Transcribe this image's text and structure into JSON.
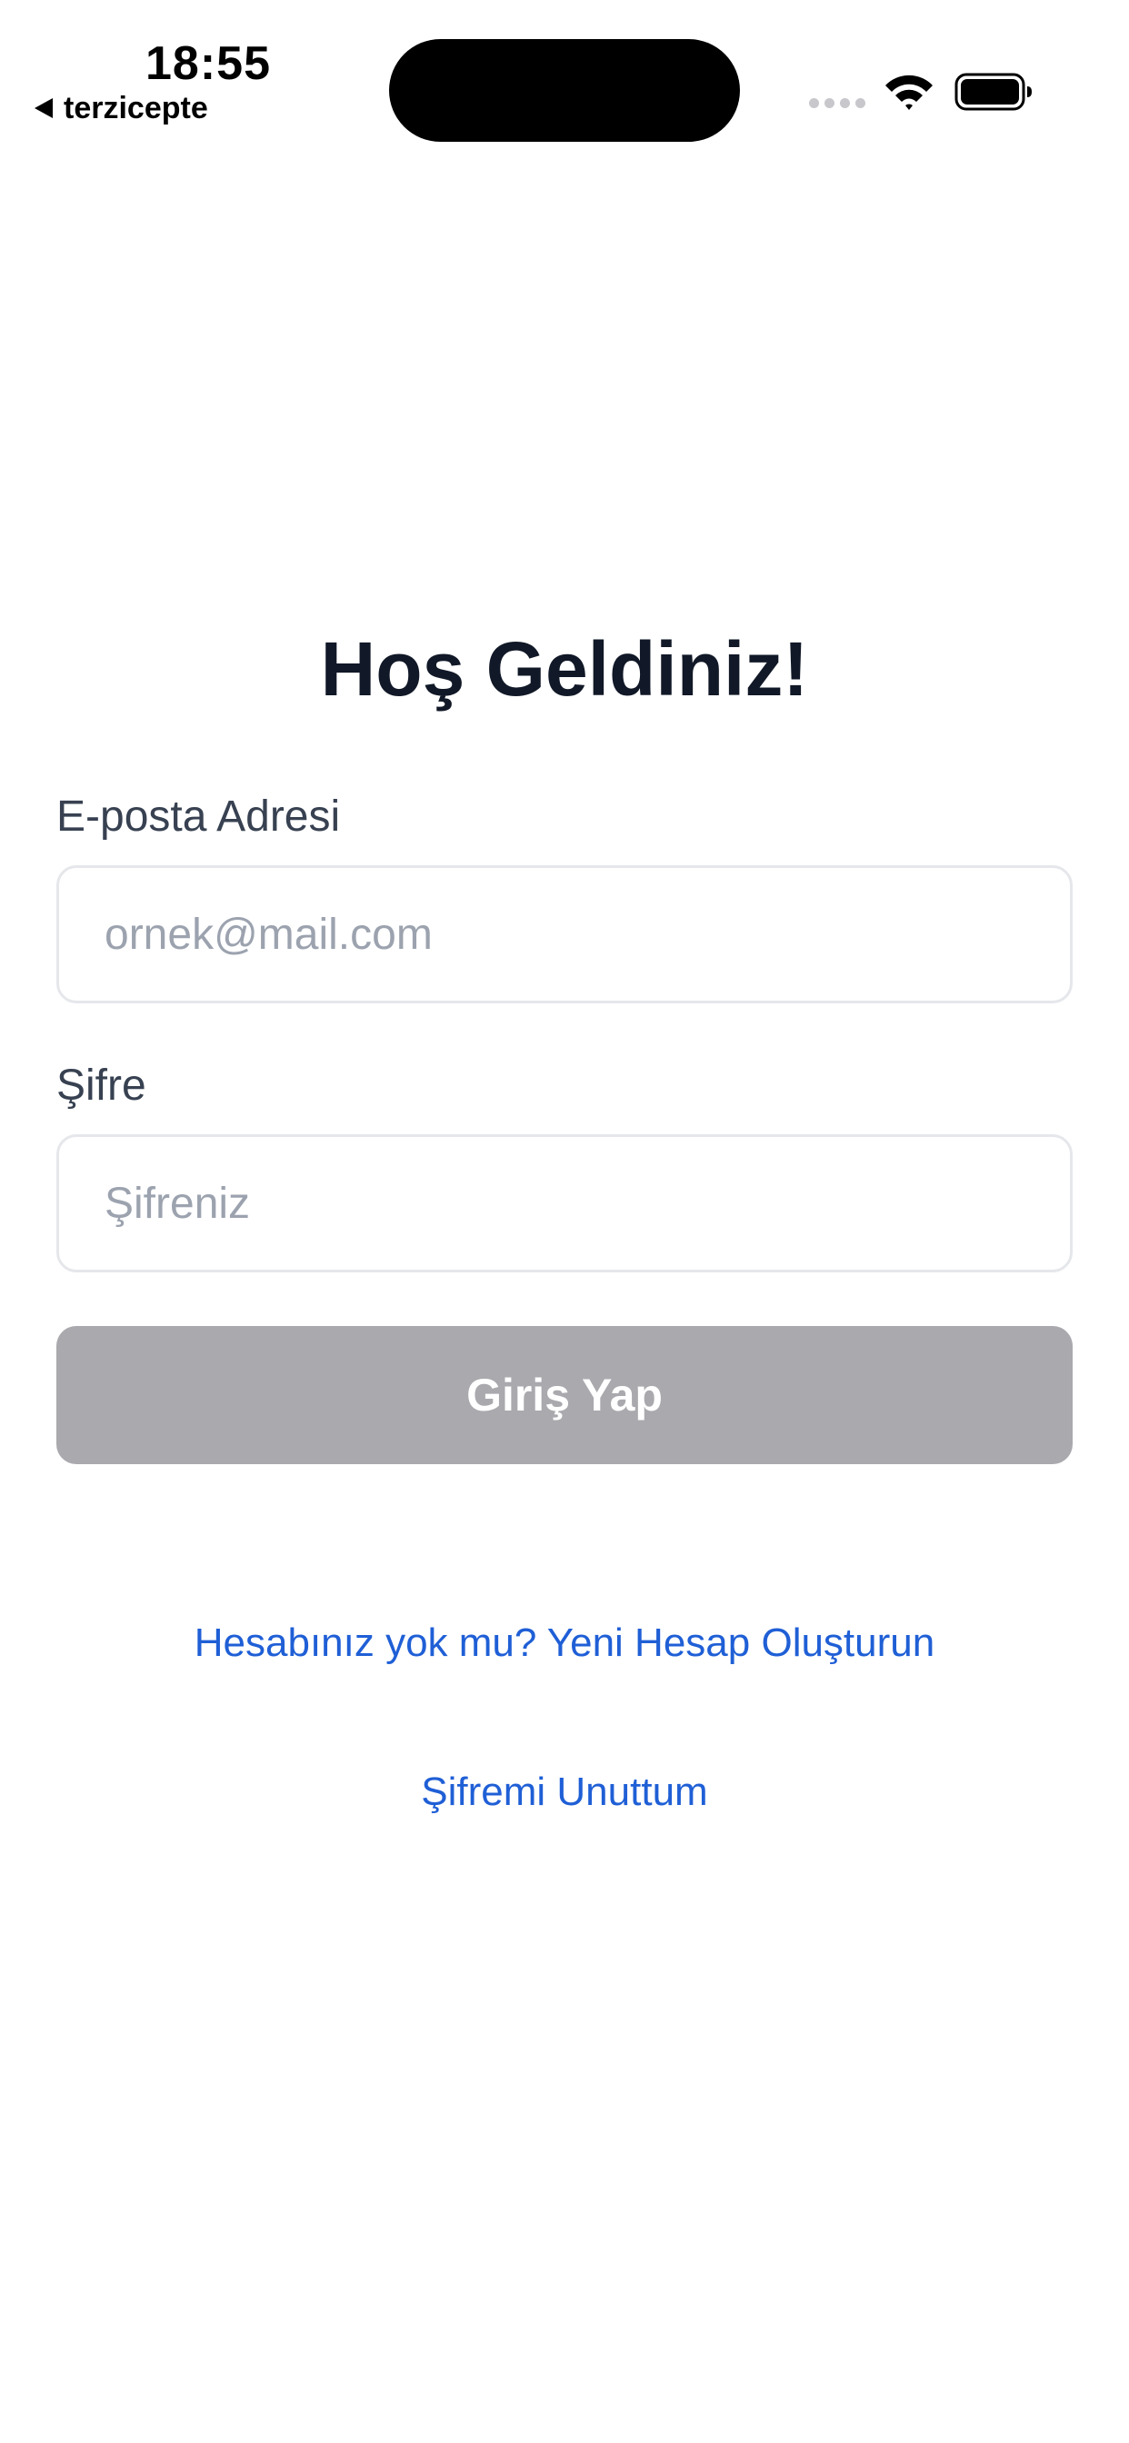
{
  "status_bar": {
    "time": "18:55",
    "back_app": "terzicepte",
    "icons": [
      "back-triangle-icon",
      "signal-icon",
      "wifi-icon",
      "battery-icon"
    ]
  },
  "login": {
    "title": "Hoş Geldiniz!",
    "email": {
      "label": "E-posta Adresi",
      "placeholder": "ornek@mail.com",
      "value": ""
    },
    "password": {
      "label": "Şifre",
      "placeholder": "Şifreniz",
      "value": ""
    },
    "submit_label": "Giriş Yap",
    "signup_link": "Hesabınız yok mu? Yeni Hesap Oluşturun",
    "forgot_link": "Şifremi Unuttum"
  },
  "colors": {
    "background": "#ffffff",
    "title": "#111827",
    "label": "#374151",
    "placeholder": "#9ca3af",
    "input_border": "#e5e7eb",
    "button_disabled": "#a9a9ae",
    "button_text": "#ffffff",
    "link": "#1f5fd6"
  }
}
